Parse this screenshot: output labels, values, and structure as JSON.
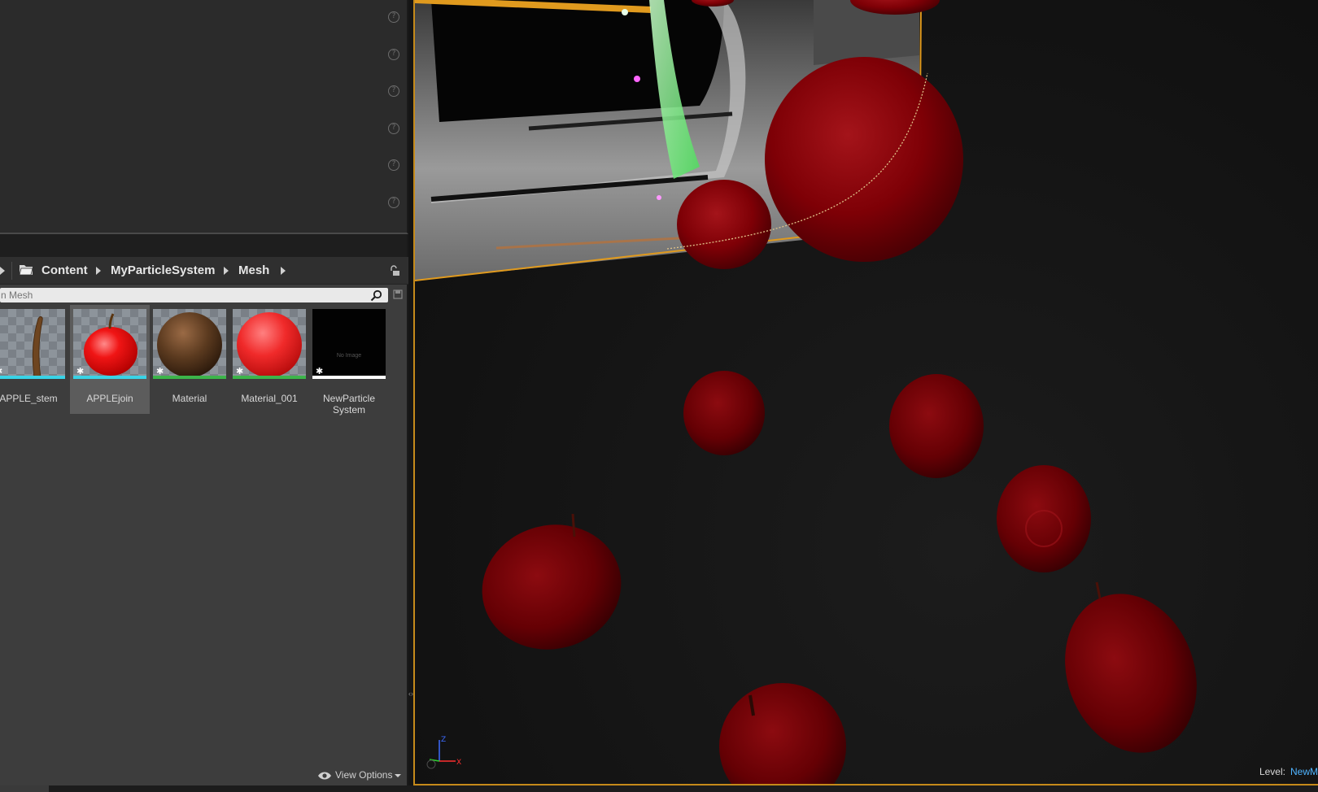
{
  "content_browser": {
    "breadcrumb": [
      "Content",
      "MyParticleSystem",
      "Mesh"
    ],
    "search": {
      "placeholder": "n Mesh"
    },
    "assets": [
      {
        "label": "APPLE_stem",
        "kind": "mesh",
        "bar_color": "#39d3e6"
      },
      {
        "label": "APPLEjoin",
        "kind": "mesh",
        "bar_color": "#39d3e6",
        "selected": true
      },
      {
        "label": "Material",
        "kind": "material",
        "bar_color": "#3cb54a"
      },
      {
        "label": "Material_001",
        "kind": "material",
        "bar_color": "#3cb54a"
      },
      {
        "label": "NewParticle System",
        "kind": "particle_system",
        "bar_color": "#ffffff",
        "thumb_text": "No Image"
      }
    ],
    "view_options_label": "View Options"
  },
  "viewport": {
    "level_label": "Level:",
    "level_value": "NewM",
    "axis_labels": {
      "x": "X",
      "z": "Z"
    }
  },
  "colors": {
    "panel_bg": "#2b2b2b",
    "browser_bg": "#3d3d3d",
    "selection_outline": "#c58a1a",
    "apple_red": "#8a0005",
    "particle_green": "#7dff8a"
  },
  "icons": [
    "help-icon",
    "folder-icon",
    "lock-icon",
    "search-icon",
    "save-search-icon",
    "eye-icon",
    "axis-gizmo-icon"
  ]
}
